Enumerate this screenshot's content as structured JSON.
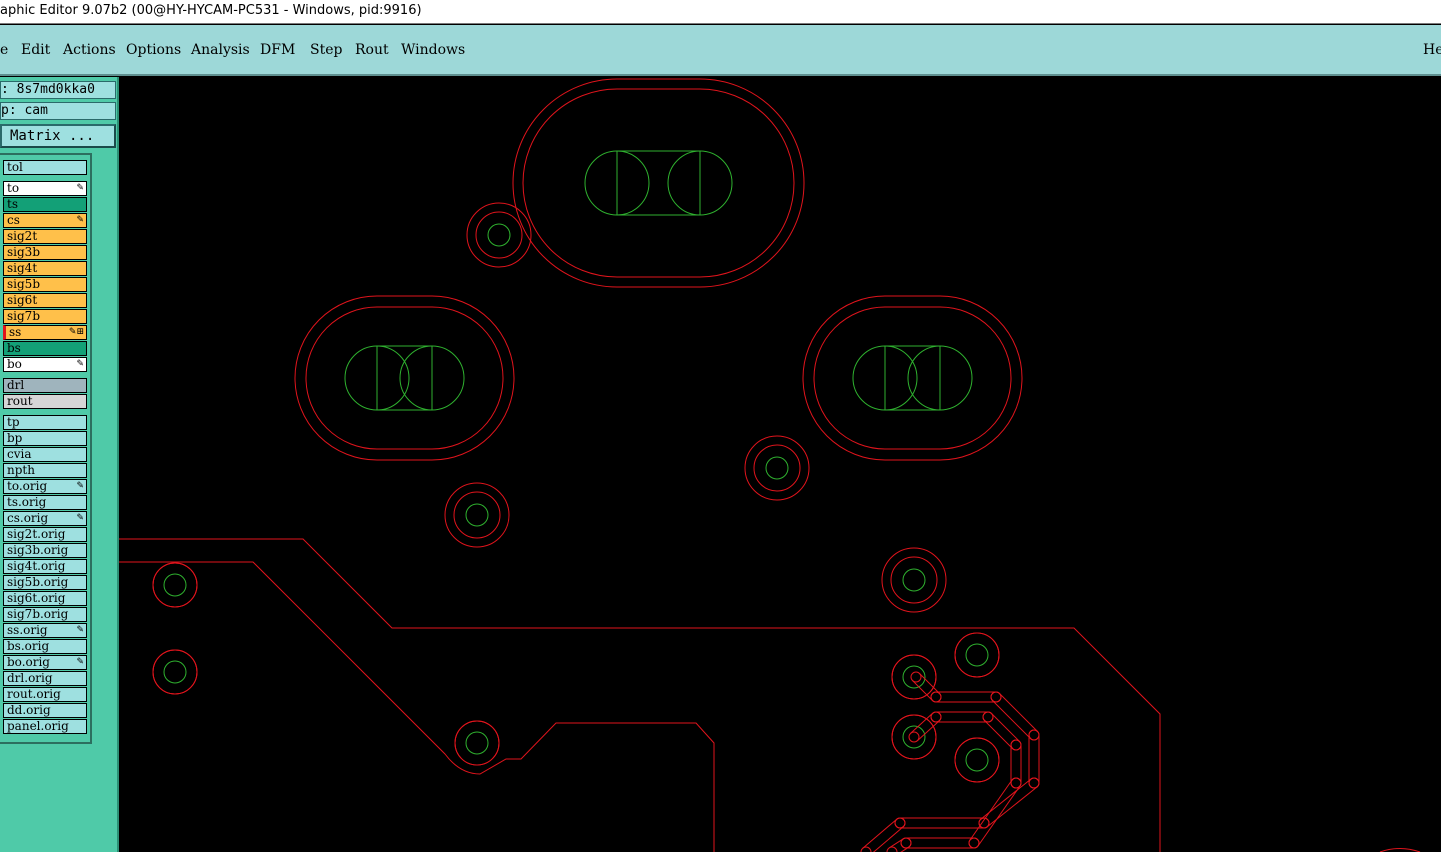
{
  "window": {
    "title": "aphic Editor 9.07b2 (00@HY-HYCAM-PC531 - Windows, pid:9916)"
  },
  "menu": [
    "e",
    "Edit",
    "Actions",
    "Options",
    "Analysis",
    "DFM",
    "Step",
    "Rout",
    "Windows",
    "He"
  ],
  "panel": {
    "job_line": ": 8s7md0kka0",
    "step_line": "p: cam",
    "matrix_label": "Matrix ..."
  },
  "layers": [
    {
      "name": "tol",
      "color": "#9ee0e0"
    },
    {
      "name": "to",
      "color": "#ffffff",
      "mark": "✎"
    },
    {
      "name": "ts",
      "color": "#13a077"
    },
    {
      "name": "cs",
      "color": "#ffc04a",
      "mark": "✎"
    },
    {
      "name": "sig2t",
      "color": "#ffc04a"
    },
    {
      "name": "sig3b",
      "color": "#ffc04a"
    },
    {
      "name": "sig4t",
      "color": "#ffc04a"
    },
    {
      "name": "sig5b",
      "color": "#ffc04a"
    },
    {
      "name": "sig6t",
      "color": "#ffc04a"
    },
    {
      "name": "sig7b",
      "color": "#ffc04a"
    },
    {
      "name": "ss",
      "color": "#ffc04a",
      "mark": "✎⊞"
    },
    {
      "name": "bs",
      "color": "#13a077"
    },
    {
      "name": "bo",
      "color": "#ffffff",
      "mark": "✎"
    },
    {
      "name": "drl",
      "color": "#9fb4bd"
    },
    {
      "name": "rout",
      "color": "#d6d6d6"
    },
    {
      "name": "tp",
      "color": "#9ee0e0"
    },
    {
      "name": "bp",
      "color": "#9ee0e0"
    },
    {
      "name": "cvia",
      "color": "#9ee0e0"
    },
    {
      "name": "npth",
      "color": "#9ee0e0"
    },
    {
      "name": "to.orig",
      "color": "#9ee0e0",
      "mark": "✎"
    },
    {
      "name": "ts.orig",
      "color": "#9ee0e0"
    },
    {
      "name": "cs.orig",
      "color": "#9ee0e0",
      "mark": "✎"
    },
    {
      "name": "sig2t.orig",
      "color": "#9ee0e0"
    },
    {
      "name": "sig3b.orig",
      "color": "#9ee0e0"
    },
    {
      "name": "sig4t.orig",
      "color": "#9ee0e0"
    },
    {
      "name": "sig5b.orig",
      "color": "#9ee0e0"
    },
    {
      "name": "sig6t.orig",
      "color": "#9ee0e0"
    },
    {
      "name": "sig7b.orig",
      "color": "#9ee0e0"
    },
    {
      "name": "ss.orig",
      "color": "#9ee0e0",
      "mark": "✎"
    },
    {
      "name": "bs.orig",
      "color": "#9ee0e0"
    },
    {
      "name": "bo.orig",
      "color": "#9ee0e0",
      "mark": "✎"
    },
    {
      "name": "drl.orig",
      "color": "#9ee0e0"
    },
    {
      "name": "rout.orig",
      "color": "#9ee0e0"
    },
    {
      "name": "dd.orig",
      "color": "#9ee0e0"
    },
    {
      "name": "panel.orig",
      "color": "#9ee0e0"
    }
  ],
  "colors": {
    "canvas_bg": "#000000",
    "outline": "#e0141c",
    "drill": "#2fb12f",
    "menubar": "#9dd8d8",
    "panel": "#4fcaa8"
  }
}
